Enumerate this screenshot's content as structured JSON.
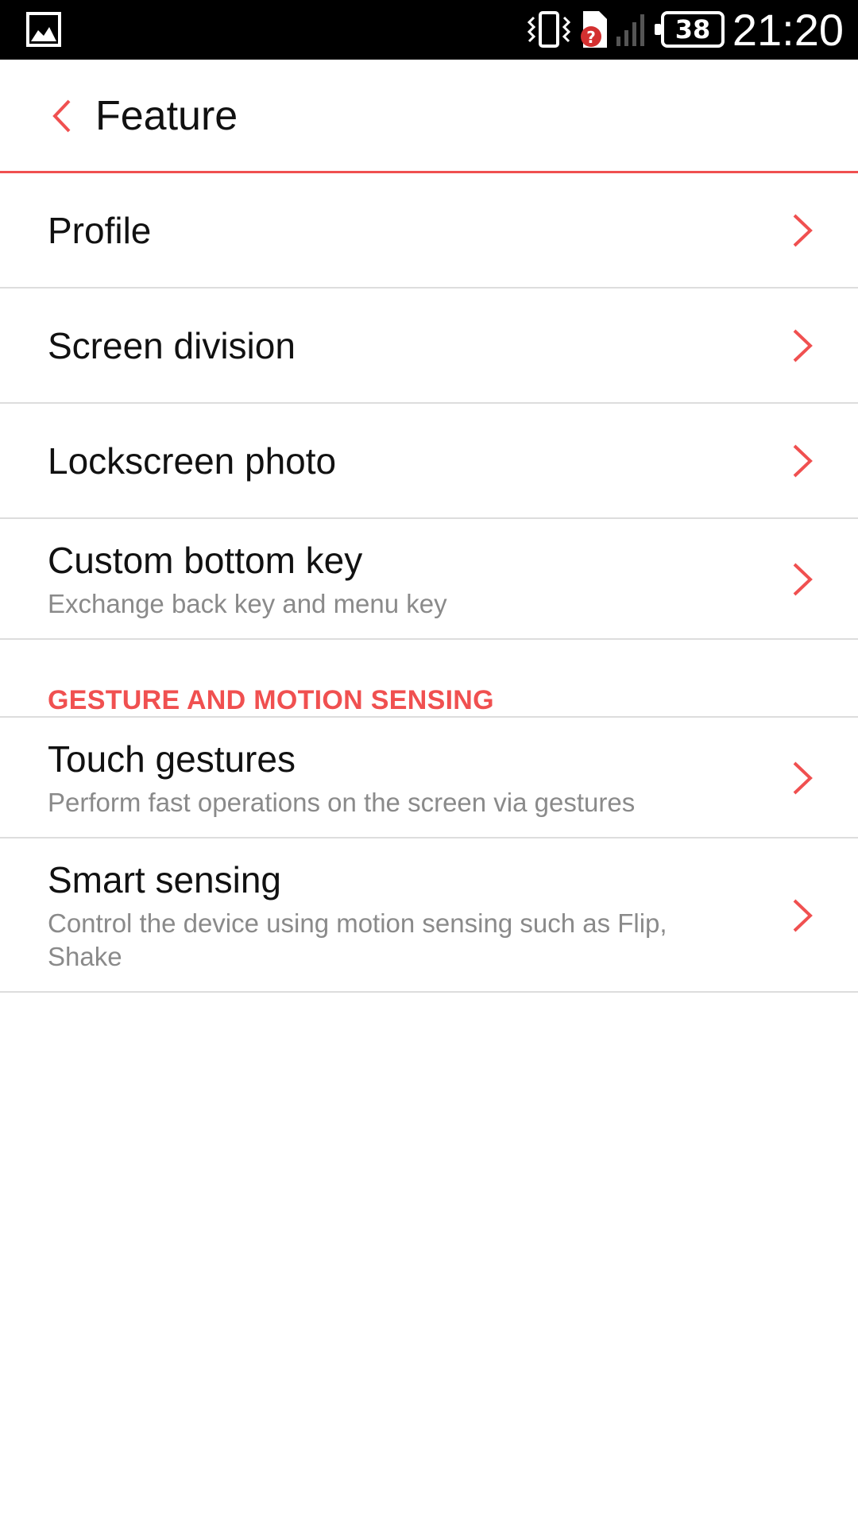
{
  "status_bar": {
    "battery_level": "38",
    "time": "21:20"
  },
  "header": {
    "title": "Feature"
  },
  "items": [
    {
      "label": "Profile"
    },
    {
      "label": "Screen division"
    },
    {
      "label": "Lockscreen photo"
    },
    {
      "label": "Custom bottom key",
      "description": "Exchange back key and menu key"
    }
  ],
  "section": {
    "label": "GESTURE AND MOTION SENSING",
    "items": [
      {
        "label": "Touch gestures",
        "description": "Perform fast operations on the screen via gestures"
      },
      {
        "label": "Smart sensing",
        "description": "Control the device using motion sensing such as Flip, Shake"
      }
    ]
  },
  "colors": {
    "accent": "#f05050",
    "status_bar": "#000000",
    "divider": "#dddddd",
    "secondary_text": "#8a8a8a"
  }
}
